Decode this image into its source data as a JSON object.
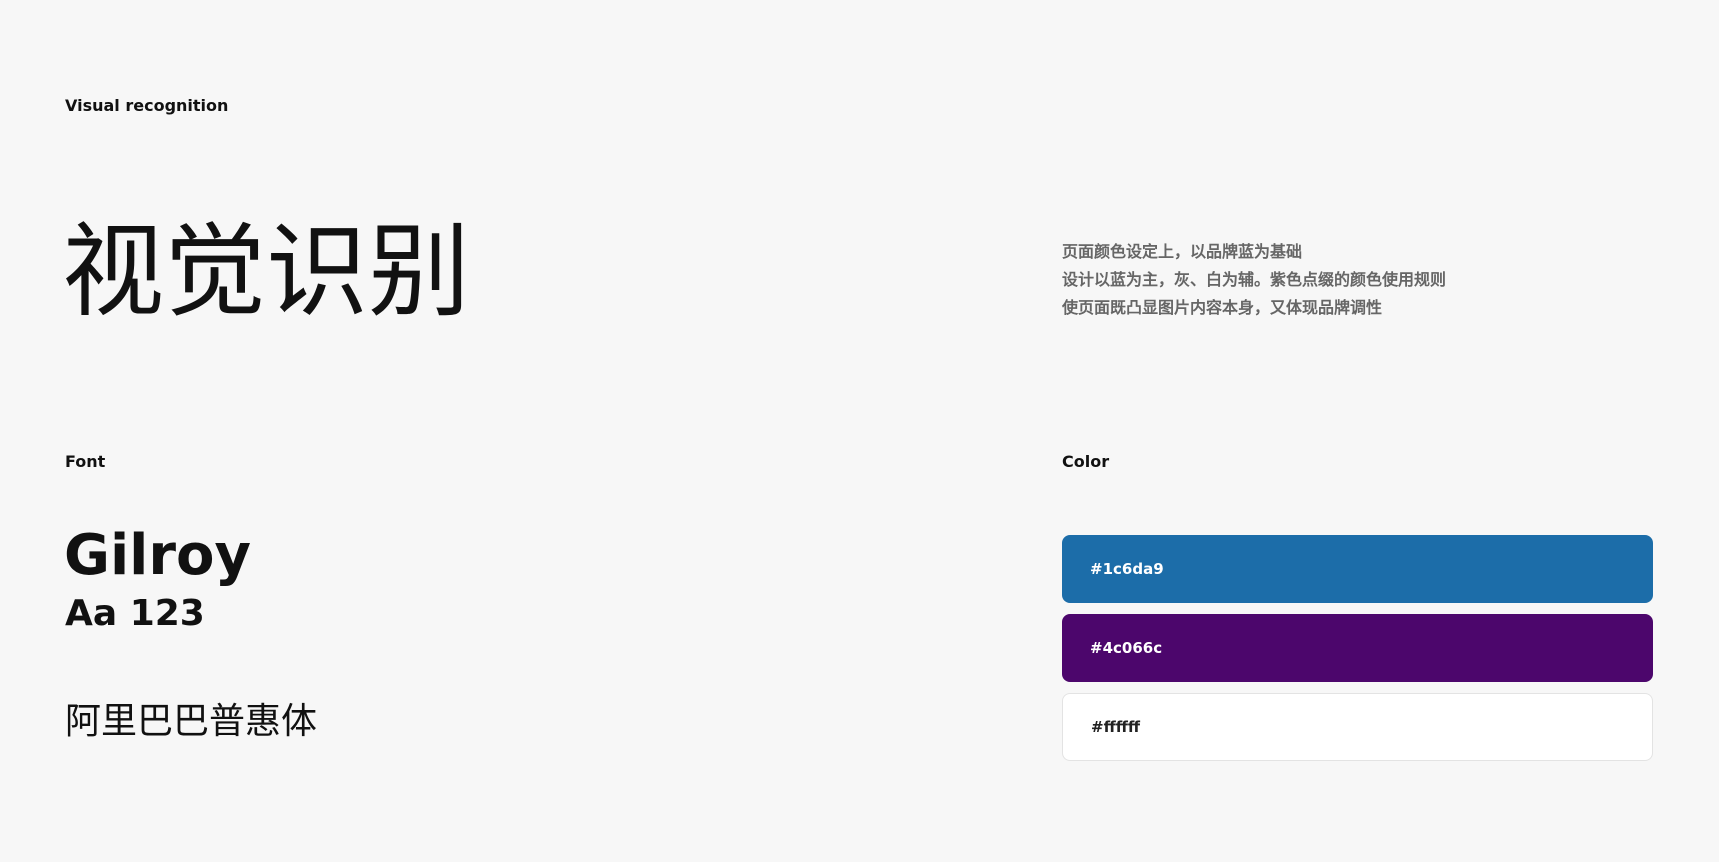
{
  "header": {
    "eyebrow": "Visual recognition",
    "title": "视觉识别"
  },
  "description": {
    "lines": [
      "页面颜色设定上，以品牌蓝为基础",
      "设计以蓝为主，灰、白为辅。紫色点缀的颜色使用规则",
      "使页面既凸显图片内容本身，又体现品牌调性"
    ]
  },
  "font": {
    "label": "Font",
    "name": "Gilroy",
    "sample": "Aa 123",
    "chinese_font": "阿里巴巴普惠体"
  },
  "color": {
    "label": "Color",
    "swatches": [
      {
        "hex": "#1c6da9",
        "text_color": "#ffffff"
      },
      {
        "hex": "#4c066c",
        "text_color": "#ffffff"
      },
      {
        "hex": "#ffffff",
        "text_color": "#222222"
      }
    ]
  }
}
